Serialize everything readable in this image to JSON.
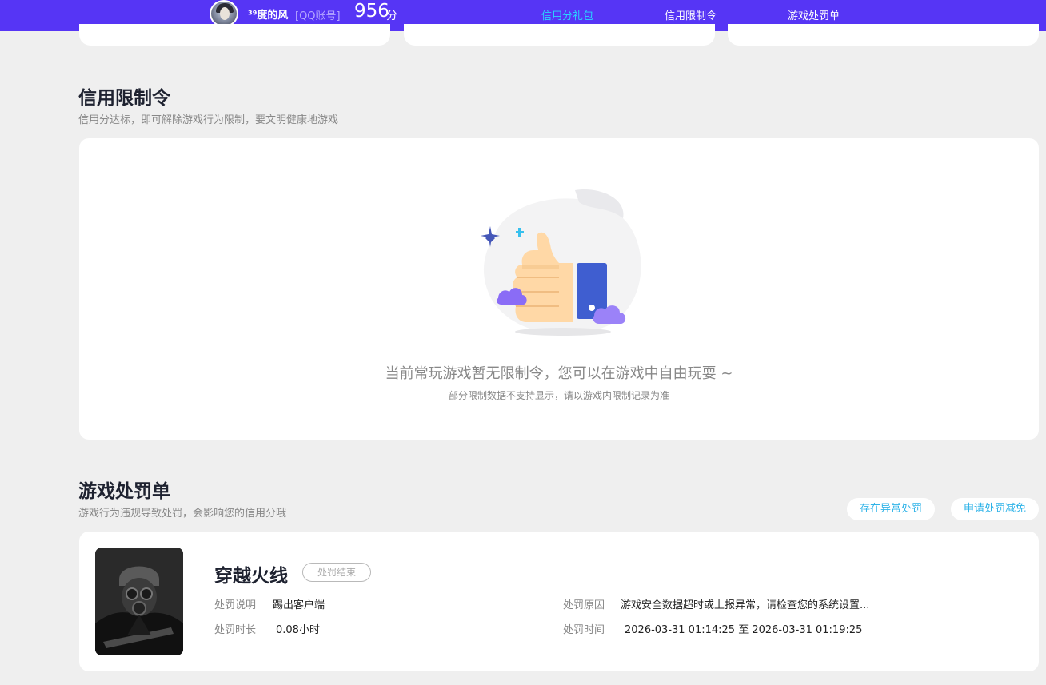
{
  "header": {
    "username": "³⁹度的风",
    "account_tag": "[QQ账号]",
    "score": "956",
    "score_unit": "分",
    "tabs": [
      {
        "label": "信用分礼包",
        "active": true
      },
      {
        "label": "信用限制令",
        "active": false
      },
      {
        "label": "游戏处罚单",
        "active": false
      }
    ]
  },
  "restriction": {
    "title": "信用限制令",
    "subtitle": "信用分达标，即可解除游戏行为限制，要文明健康地游戏",
    "empty_message": "当前常玩游戏暂无限制令，您可以在游戏中自由玩耍 ~",
    "empty_note": "部分限制数据不支持显示，请以游戏内限制记录为准"
  },
  "punishment": {
    "title": "游戏处罚单",
    "subtitle": "游戏行为违规导致处罚，会影响您的信用分哦",
    "abnormal_button": "存在异常处罚",
    "reduce_button": "申请处罚减免",
    "record": {
      "game": "穿越火线",
      "status": "处罚结束",
      "desc_label": "处罚说明",
      "desc_value": "踢出客户端",
      "duration_label": "处罚时长",
      "duration_value": "0.08小时",
      "reason_label": "处罚原因",
      "reason_value": "游戏安全数据超时或上报异常，请检查您的系统设置...",
      "time_label": "处罚时间",
      "time_value": "2026-03-31 01:14:25 至 2026-03-31 01:19:25"
    }
  },
  "colors": {
    "topbar": "#5635f5",
    "active_tab": "#28d7ff",
    "link": "#2fb3e8",
    "background": "#efefef"
  }
}
